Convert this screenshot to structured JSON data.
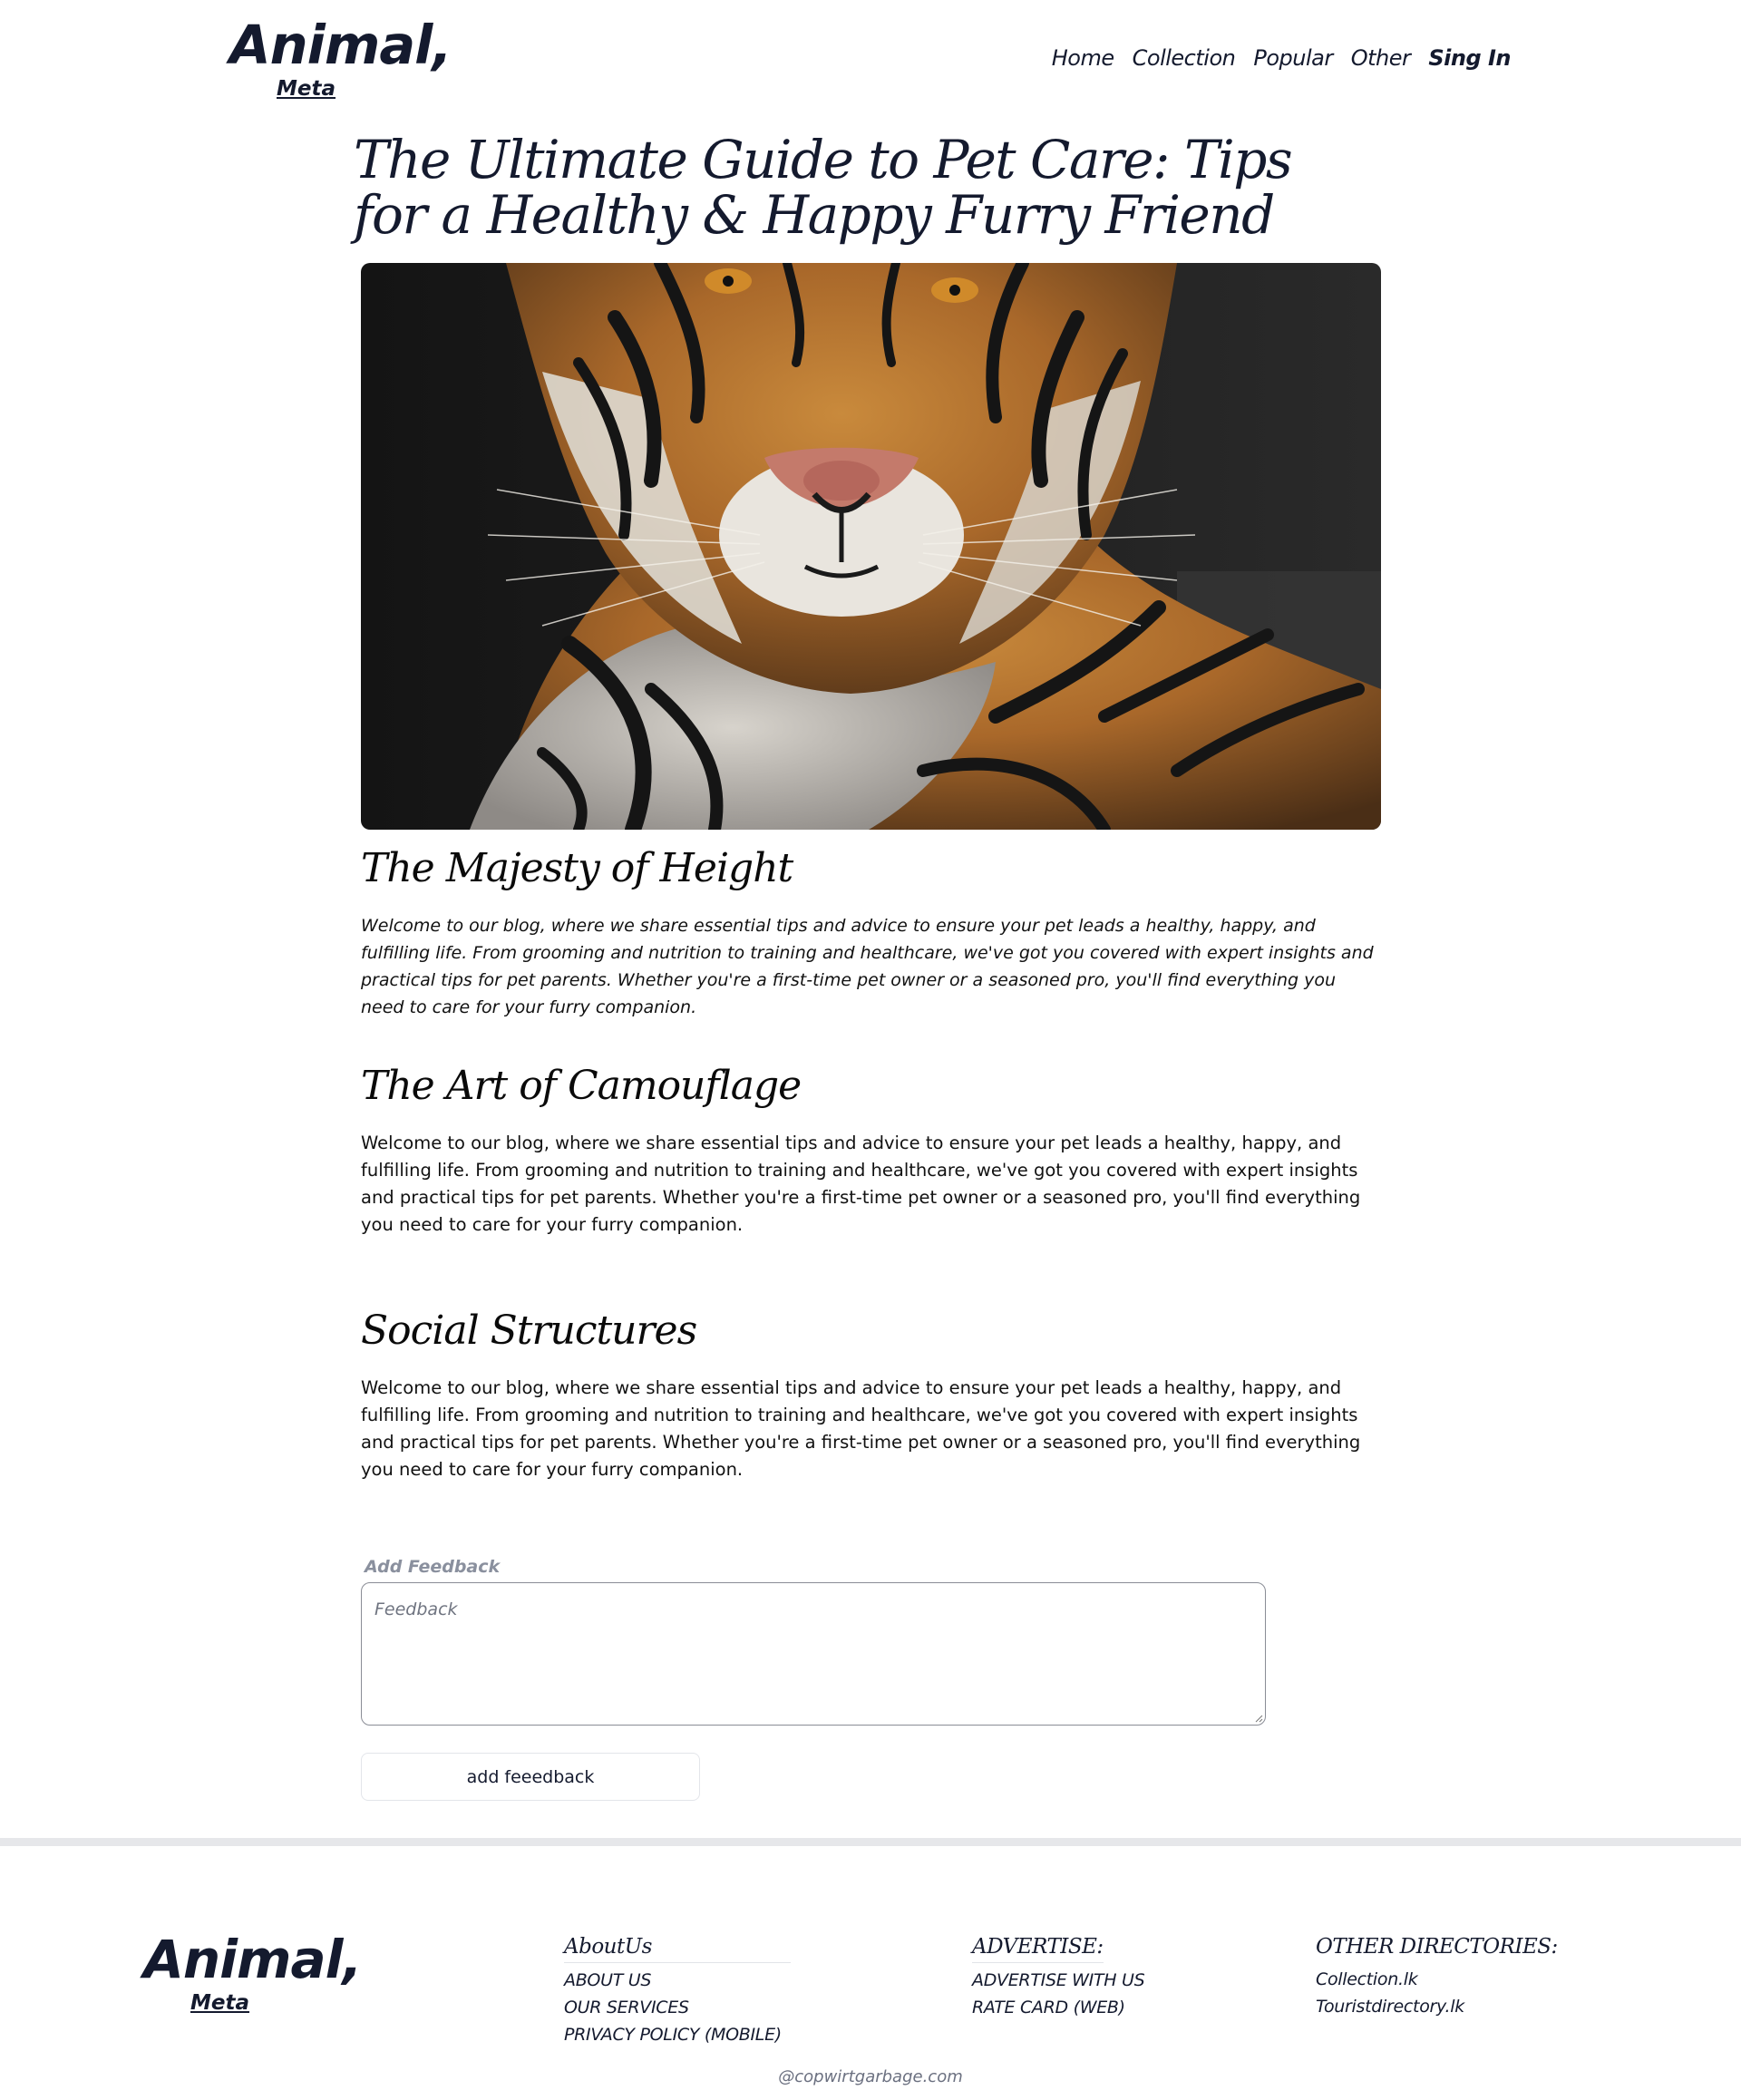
{
  "brand": {
    "name": "Animal,",
    "subtitle": "Meta"
  },
  "nav": {
    "items": [
      {
        "label": "Home"
      },
      {
        "label": "Collection"
      },
      {
        "label": "Popular"
      },
      {
        "label": "Other"
      }
    ],
    "sign_in_label": "Sing In"
  },
  "article": {
    "title": "The Ultimate Guide to Pet Care: Tips for a Healthy & Happy Furry Friend",
    "hero_image": "tiger-portrait-photo",
    "sections": [
      {
        "heading": "The Majesty of Height",
        "text": "Welcome to our blog, where we share essential tips and advice to ensure your pet leads a healthy, happy, and fulfilling life. From grooming and nutrition to training and healthcare, we've got you covered with expert insights and practical tips for pet parents. Whether you're a first-time pet owner or a seasoned pro, you'll find everything you need to care for your furry companion."
      },
      {
        "heading": "The Art of Camouflage",
        "text": "Welcome to our blog, where we share essential tips and advice to ensure your pet leads a healthy, happy, and fulfilling life. From grooming and nutrition to training and healthcare, we've got you covered with expert insights and practical tips for pet parents. Whether you're a first-time pet owner or a seasoned pro, you'll find everything you need to care for your furry companion."
      },
      {
        "heading": "Social Structures",
        "text": "Welcome to our blog, where we share essential tips and advice to ensure your pet leads a healthy, happy, and fulfilling life. From grooming and nutrition to training and healthcare, we've got you covered with expert insights and practical tips for pet parents. Whether you're a first-time pet owner or a seasoned pro, you'll find everything you need to care for your furry companion."
      }
    ]
  },
  "feedback": {
    "label": "Add Feedback",
    "placeholder": "Feedback",
    "value": "",
    "button_label": "add feeedback"
  },
  "footer": {
    "about": {
      "title": "AboutUs",
      "links": [
        "ABOUT US",
        "OUR SERVICES",
        "PRIVACY POLICY (MOBILE)"
      ]
    },
    "advertise": {
      "title": "ADVERTISE:",
      "links": [
        "ADVERTISE WITH US",
        "RATE CARD (WEB)"
      ]
    },
    "other": {
      "title": "OTHER DIRECTORIES:",
      "links": [
        "Collection.lk",
        "Touristdirectory.lk"
      ]
    },
    "copyright": "@copwirtgarbage.com"
  },
  "colors": {
    "text": "#141a2e",
    "divider": "#e6e7ea",
    "muted": "#8a909e"
  }
}
